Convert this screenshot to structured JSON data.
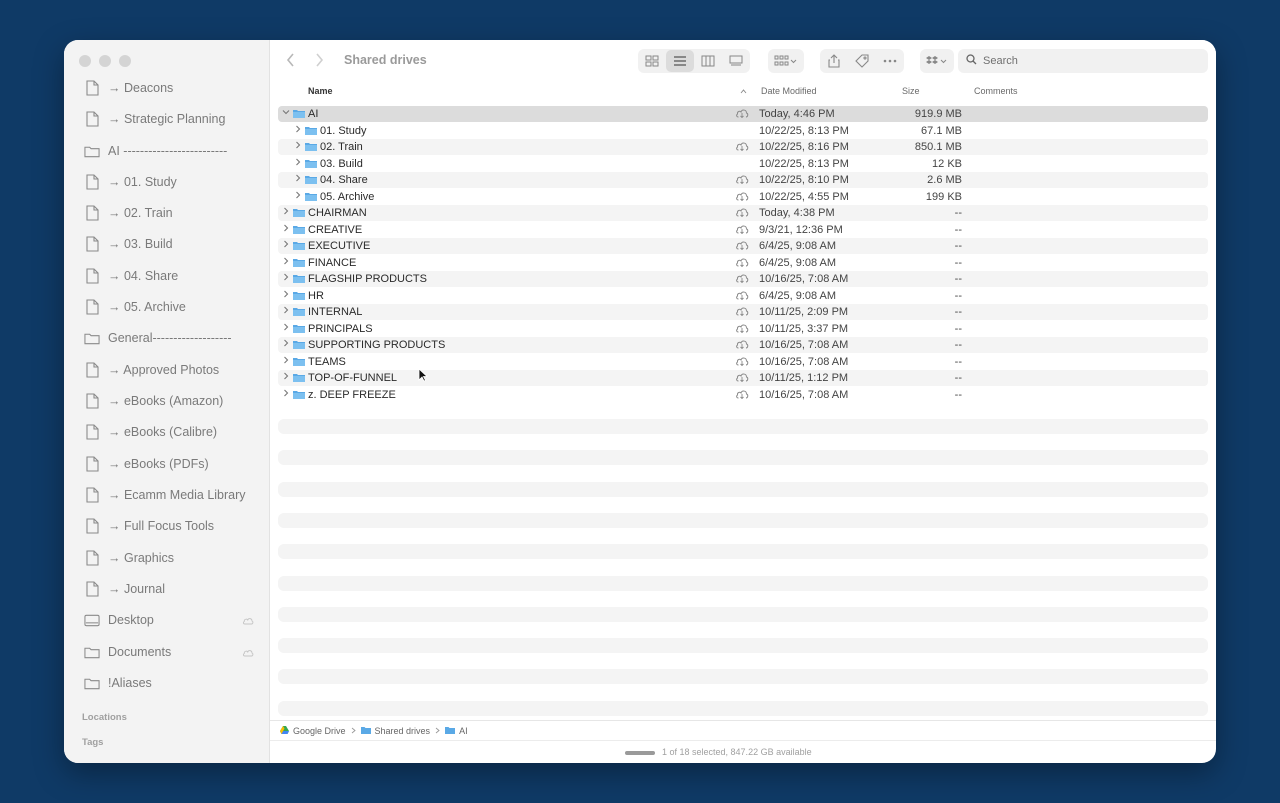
{
  "window": {
    "title": "Shared drives"
  },
  "sidebar": {
    "items": [
      {
        "label": "→ Deacons",
        "icon": "doc-icon"
      },
      {
        "label": "→ Strategic Planning",
        "icon": "doc-icon"
      },
      {
        "label": "AI -------------------------",
        "icon": "folder-icon"
      },
      {
        "label": "→ 01. Study",
        "icon": "doc-icon"
      },
      {
        "label": "→ 02. Train",
        "icon": "doc-icon"
      },
      {
        "label": "→ 03. Build",
        "icon": "doc-icon"
      },
      {
        "label": "→ 04. Share",
        "icon": "doc-icon"
      },
      {
        "label": "→ 05. Archive",
        "icon": "doc-icon"
      },
      {
        "label": "General-------------------",
        "icon": "folder-icon"
      },
      {
        "label": "→ Approved Photos",
        "icon": "doc-icon"
      },
      {
        "label": "→ eBooks (Amazon)",
        "icon": "doc-icon"
      },
      {
        "label": "→ eBooks (Calibre)",
        "icon": "doc-icon"
      },
      {
        "label": "→ eBooks (PDFs)",
        "icon": "doc-icon"
      },
      {
        "label": "→ Ecamm Media Library",
        "icon": "doc-icon"
      },
      {
        "label": "→ Full Focus Tools",
        "icon": "doc-icon"
      },
      {
        "label": "→ Graphics",
        "icon": "doc-icon"
      },
      {
        "label": "→ Journal",
        "icon": "doc-icon"
      },
      {
        "label": "Desktop",
        "icon": "desktop-icon"
      },
      {
        "label": "Documents",
        "icon": "documents-icon"
      },
      {
        "label": "!Aliases",
        "icon": "folder-icon"
      }
    ],
    "sections": {
      "locations": "Locations",
      "tags": "Tags"
    }
  },
  "toolbar": {
    "search_label": "Search"
  },
  "columns": {
    "name": "Name",
    "date": "Date Modified",
    "size": "Size",
    "comments": "Comments"
  },
  "rows": [
    {
      "name": "AI",
      "date": "Today, 4:46 PM",
      "size": "919.9 MB",
      "level": 0,
      "expanded": true,
      "cloud": true,
      "selected": true
    },
    {
      "name": "01. Study",
      "date": "10/22/25, 8:13 PM",
      "size": "67.1 MB",
      "level": 1,
      "cloud": false
    },
    {
      "name": "02. Train",
      "date": "10/22/25, 8:16 PM",
      "size": "850.1 MB",
      "level": 1,
      "cloud": true
    },
    {
      "name": "03. Build",
      "date": "10/22/25, 8:13 PM",
      "size": "12 KB",
      "level": 1,
      "cloud": false
    },
    {
      "name": "04. Share",
      "date": "10/22/25, 8:10 PM",
      "size": "2.6 MB",
      "level": 1,
      "cloud": true
    },
    {
      "name": "05. Archive",
      "date": "10/22/25, 4:55 PM",
      "size": "199 KB",
      "level": 1,
      "cloud": true
    },
    {
      "name": "CHAIRMAN",
      "date": "Today, 4:38 PM",
      "size": "--",
      "level": 0,
      "cloud": true
    },
    {
      "name": "CREATIVE",
      "date": "9/3/21, 12:36 PM",
      "size": "--",
      "level": 0,
      "cloud": true
    },
    {
      "name": "EXECUTIVE",
      "date": "6/4/25, 9:08 AM",
      "size": "--",
      "level": 0,
      "cloud": true
    },
    {
      "name": "FINANCE",
      "date": "6/4/25, 9:08 AM",
      "size": "--",
      "level": 0,
      "cloud": true
    },
    {
      "name": "FLAGSHIP PRODUCTS",
      "date": "10/16/25, 7:08 AM",
      "size": "--",
      "level": 0,
      "cloud": true
    },
    {
      "name": "HR",
      "date": "6/4/25, 9:08 AM",
      "size": "--",
      "level": 0,
      "cloud": true
    },
    {
      "name": "INTERNAL",
      "date": "10/11/25, 2:09 PM",
      "size": "--",
      "level": 0,
      "cloud": true
    },
    {
      "name": "PRINCIPALS",
      "date": "10/11/25, 3:37 PM",
      "size": "--",
      "level": 0,
      "cloud": true
    },
    {
      "name": "SUPPORTING PRODUCTS",
      "date": "10/16/25, 7:08 AM",
      "size": "--",
      "level": 0,
      "cloud": true
    },
    {
      "name": "TEAMS",
      "date": "10/16/25, 7:08 AM",
      "size": "--",
      "level": 0,
      "cloud": true
    },
    {
      "name": "TOP-OF-FUNNEL",
      "date": "10/11/25, 1:12 PM",
      "size": "--",
      "level": 0,
      "cloud": true
    },
    {
      "name": "z. DEEP FREEZE",
      "date": "10/16/25, 7:08 AM",
      "size": "--",
      "level": 0,
      "cloud": true
    }
  ],
  "pathbar": [
    "Google Drive",
    "Shared drives",
    "AI"
  ],
  "status": "1 of 18 selected, 847.22 GB available",
  "colors": {
    "folder": "#5aa9e6",
    "background": "#0f3a66",
    "selected": "#dcdcdc"
  }
}
